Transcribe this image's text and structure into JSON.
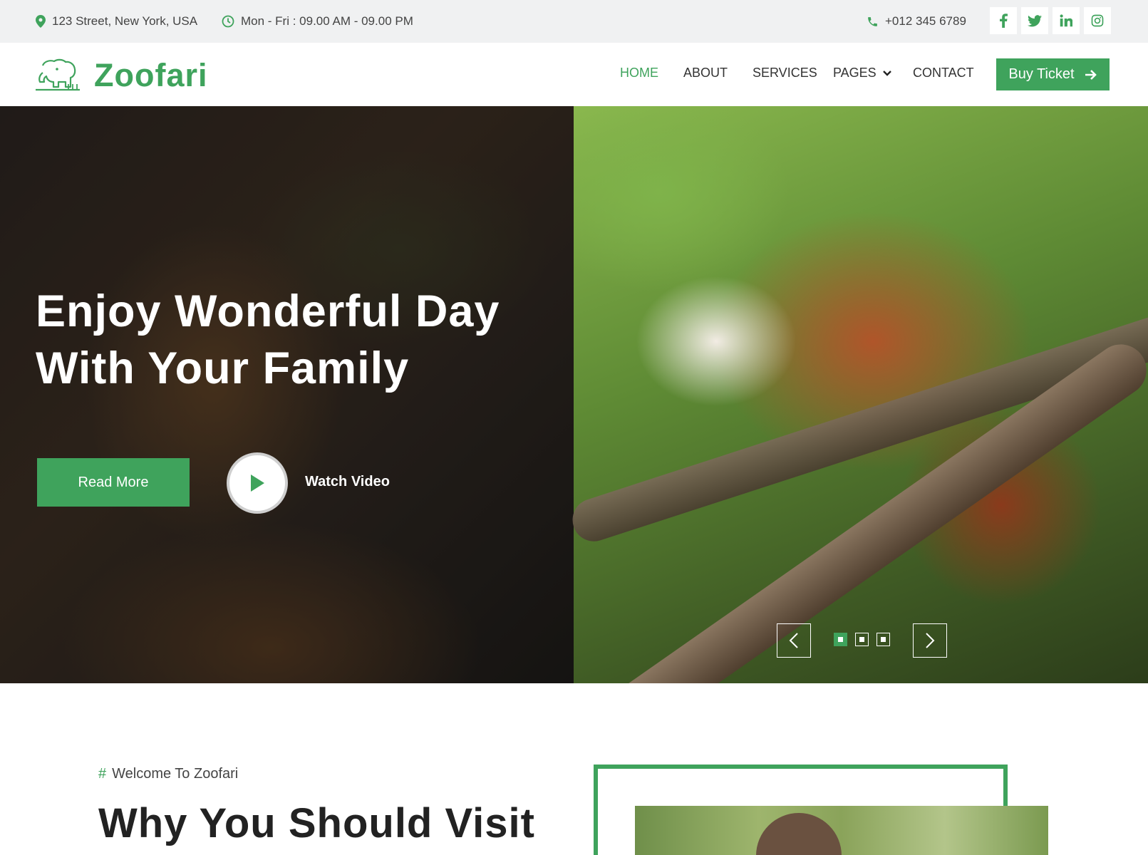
{
  "topbar": {
    "address": "123 Street, New York, USA",
    "hours": "Mon - Fri : 09.00 AM - 09.00 PM",
    "phone": "+012 345 6789",
    "socials": [
      "facebook-icon",
      "twitter-icon",
      "linkedin-icon",
      "instagram-icon"
    ]
  },
  "brand": {
    "name": "Zoofari"
  },
  "nav": {
    "items": [
      "HOME",
      "ABOUT",
      "SERVICES",
      "PAGES",
      "CONTACT"
    ],
    "active": "HOME",
    "cta": "Buy Ticket"
  },
  "hero": {
    "title_line1": "Enjoy Wonderful Day",
    "title_line2": "With Your Family",
    "read_more": "Read More",
    "watch_video": "Watch Video",
    "slides": 3,
    "active_slide": 1
  },
  "about": {
    "tag": "Welcome To Zoofari",
    "title": "Why You Should Visit"
  },
  "colors": {
    "accent": "#3fa35c",
    "topbar_bg": "#f0f1f2"
  }
}
